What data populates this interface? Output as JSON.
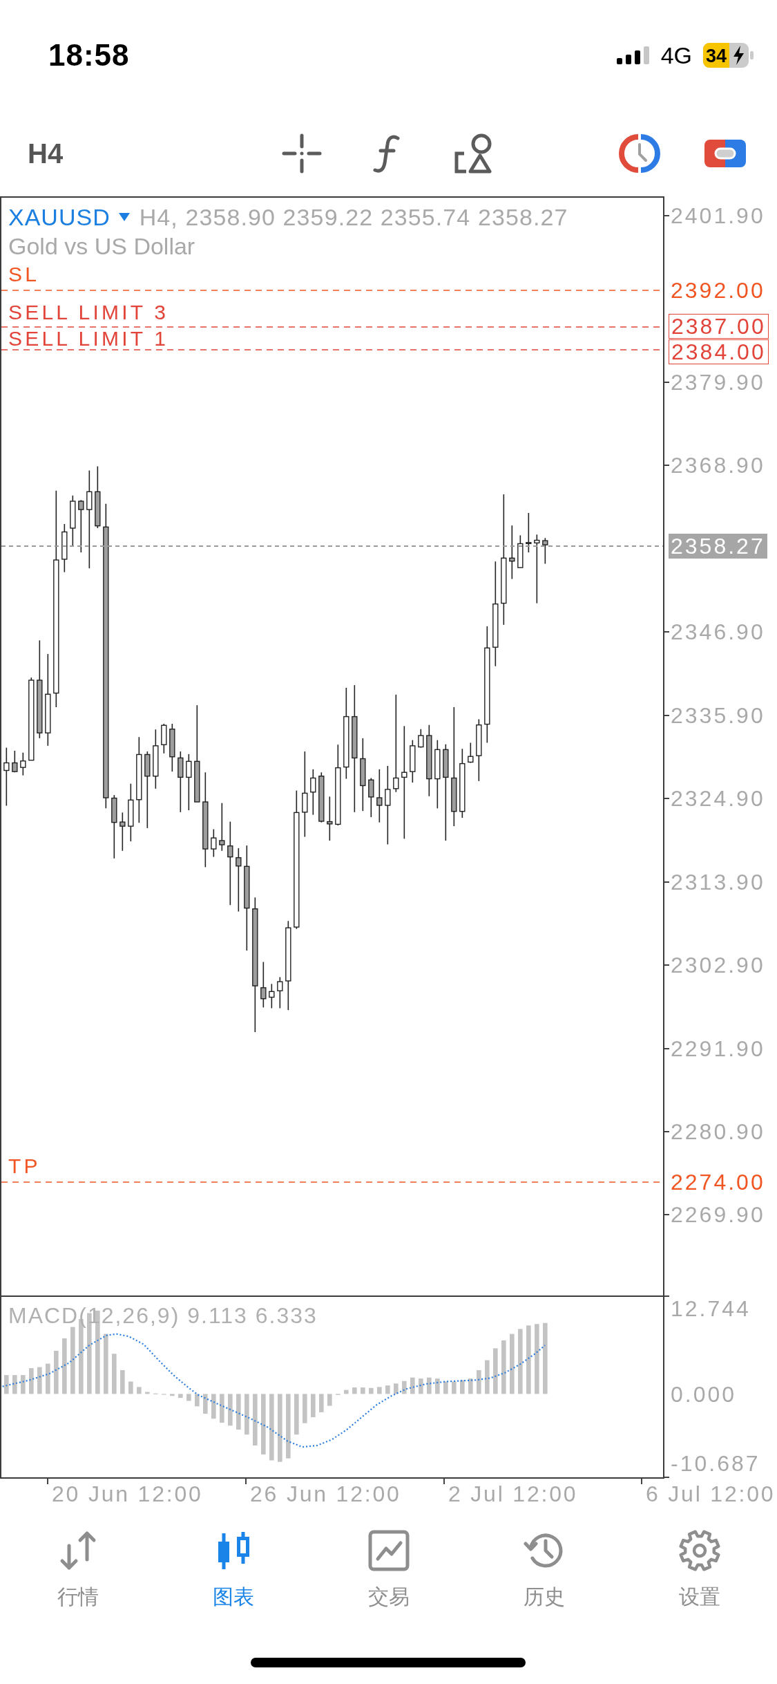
{
  "status_bar": {
    "time": "18:58",
    "network": "4G",
    "battery": "34",
    "charging": true
  },
  "toolbar": {
    "timeframe": "H4"
  },
  "chart": {
    "symbol": "XAUUSD",
    "quote": "H4, 2358.90 2359.22 2355.74 2358.27",
    "description": "Gold vs US Dollar",
    "order_lines": [
      {
        "label": "SL",
        "price": "2392.00",
        "kind": "sl"
      },
      {
        "label": "SELL LIMIT 3",
        "price": "2387.00",
        "kind": "pending"
      },
      {
        "label": "SELL LIMIT 1",
        "price": "2384.00",
        "kind": "pending"
      },
      {
        "label": "TP",
        "price": "2274.00",
        "kind": "tp"
      }
    ],
    "price_axis": [
      "2401.90",
      "2379.90",
      "2368.90",
      "2346.90",
      "2335.90",
      "2324.90",
      "2313.90",
      "2302.90",
      "2291.90",
      "2280.90",
      "2269.90"
    ],
    "current_price": "2358.27"
  },
  "macd": {
    "label": "MACD(12,26,9) 9.113 6.333",
    "axis": [
      "12.744",
      "0.000",
      "-10.687"
    ]
  },
  "time_axis": [
    "20 Jun 12:00",
    "26 Jun 12:00",
    "2 Jul 12:00",
    "6 Jul 12:00"
  ],
  "tab_bar": [
    {
      "label": "行情",
      "selected": false
    },
    {
      "label": "图表",
      "selected": true
    },
    {
      "label": "交易",
      "selected": false
    },
    {
      "label": "历史",
      "selected": false
    },
    {
      "label": "设置",
      "selected": false
    }
  ]
}
